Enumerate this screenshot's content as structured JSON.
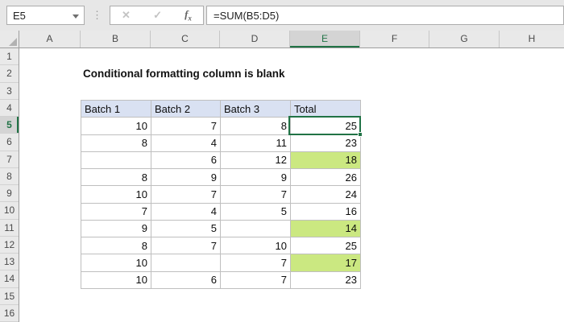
{
  "chrome": {
    "name_box": {
      "value": "E5"
    },
    "formula_bar": {
      "value": "=SUM(B5:D5)"
    },
    "icons": {
      "dropdown": "",
      "drag_dots": "⋮",
      "cancel": "✕",
      "enter": "✓",
      "fx_f": "f",
      "fx_x": "x"
    }
  },
  "sheet": {
    "title": "Conditional formatting column is blank",
    "selected_cell": "E5",
    "selected_column": "E",
    "selected_row": "5",
    "column_headers": [
      "A",
      "B",
      "C",
      "D",
      "E",
      "F",
      "G",
      "H"
    ],
    "row_headers": [
      "1",
      "2",
      "3",
      "4",
      "5",
      "6",
      "7",
      "8",
      "9",
      "10",
      "11",
      "12",
      "13",
      "14",
      "15",
      "16"
    ],
    "table": {
      "range": "B4:E14",
      "headers": [
        "Batch 1",
        "Batch 2",
        "Batch 3",
        "Total"
      ],
      "rows": [
        {
          "cells": [
            "10",
            "7",
            "8",
            "25"
          ],
          "highlight": false
        },
        {
          "cells": [
            "8",
            "4",
            "11",
            "23"
          ],
          "highlight": false
        },
        {
          "cells": [
            "",
            "6",
            "12",
            "18"
          ],
          "highlight": true
        },
        {
          "cells": [
            "8",
            "9",
            "9",
            "26"
          ],
          "highlight": false
        },
        {
          "cells": [
            "10",
            "7",
            "7",
            "24"
          ],
          "highlight": false
        },
        {
          "cells": [
            "7",
            "4",
            "5",
            "16"
          ],
          "highlight": false
        },
        {
          "cells": [
            "9",
            "5",
            "",
            "14"
          ],
          "highlight": true
        },
        {
          "cells": [
            "8",
            "7",
            "10",
            "25"
          ],
          "highlight": false
        },
        {
          "cells": [
            "10",
            "",
            "7",
            "17"
          ],
          "highlight": true
        },
        {
          "cells": [
            "10",
            "6",
            "7",
            "23"
          ],
          "highlight": false
        }
      ]
    },
    "colors": {
      "accent_green": "#217346",
      "highlight_fill": "#cbe881",
      "table_header_fill": "#d9e1f2"
    }
  }
}
